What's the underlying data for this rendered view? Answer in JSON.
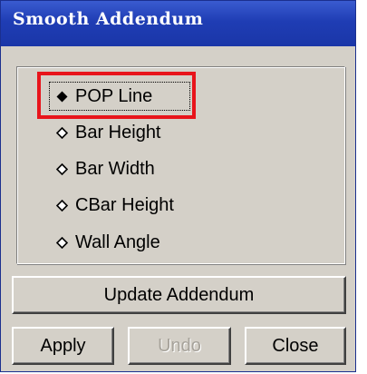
{
  "window": {
    "title": "Smooth Addendum"
  },
  "options": [
    {
      "label": "POP Line",
      "selected": true
    },
    {
      "label": "Bar Height",
      "selected": false
    },
    {
      "label": "Bar Width",
      "selected": false
    },
    {
      "label": "CBar Height",
      "selected": false
    },
    {
      "label": "Wall Angle",
      "selected": false
    }
  ],
  "buttons": {
    "update": "Update Addendum",
    "apply": "Apply",
    "undo": "Undo",
    "close": "Close"
  },
  "colors": {
    "title_bar": "#1f3db4",
    "face": "#d4d0c8",
    "highlight": "#e8141b"
  }
}
